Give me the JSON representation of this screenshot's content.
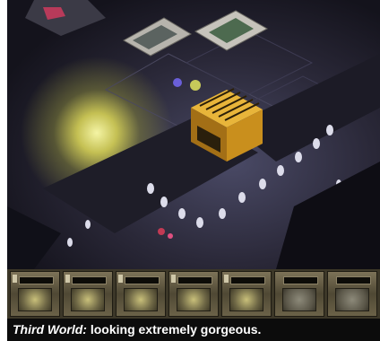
{
  "caption": {
    "title": "Third World:",
    "text": " looking extremely gorgeous."
  },
  "hud": {
    "slots": [
      {
        "portrait": "squad-member-1"
      },
      {
        "portrait": "squad-member-2"
      },
      {
        "portrait": "squad-member-3"
      },
      {
        "portrait": "squad-member-4"
      },
      {
        "portrait": "squad-member-5"
      },
      {
        "portrait": "empty"
      },
      {
        "portrait": "empty"
      }
    ]
  },
  "colors": {
    "explosion": "#fffaa0",
    "vehicle": "#d7a21f",
    "hud": "#6b6248",
    "caption_bg": "#0c0c0c"
  }
}
